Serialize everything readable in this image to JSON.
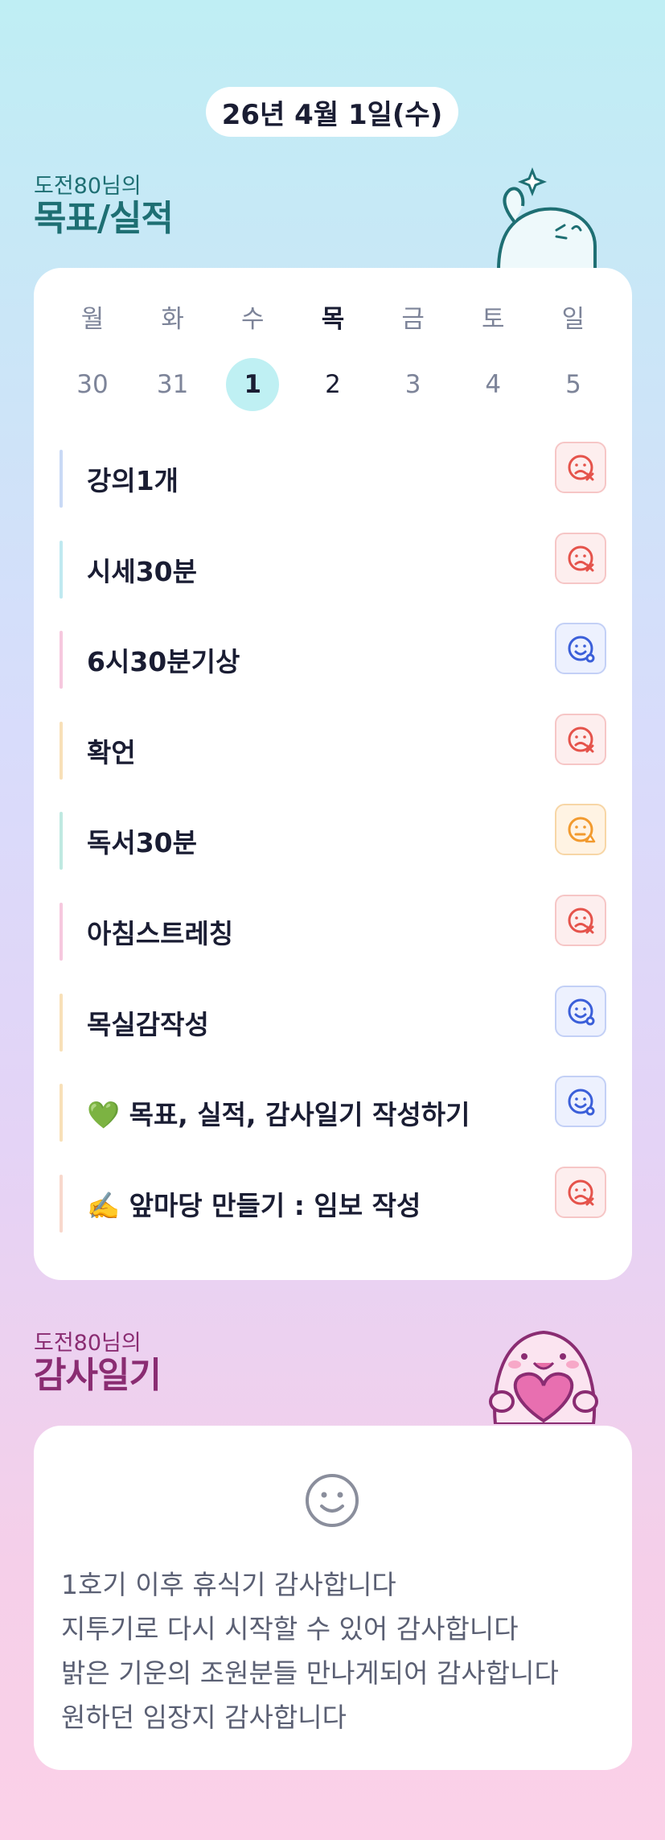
{
  "header": {
    "date": "26년 4월 1일(수)"
  },
  "goals_section": {
    "sub": "도전80님의",
    "title": "목표/실적"
  },
  "week": [
    {
      "dow": "월",
      "num": "30",
      "state": "normal"
    },
    {
      "dow": "화",
      "num": "31",
      "state": "normal"
    },
    {
      "dow": "수",
      "num": "1",
      "state": "selected"
    },
    {
      "dow": "목",
      "num": "2",
      "state": "today"
    },
    {
      "dow": "금",
      "num": "3",
      "state": "normal"
    },
    {
      "dow": "토",
      "num": "4",
      "state": "normal"
    },
    {
      "dow": "일",
      "num": "5",
      "state": "normal"
    }
  ],
  "goals": [
    {
      "text": "강의1개",
      "bar": "#c9d9f5",
      "status": "x",
      "status_icon": "sad-x-icon"
    },
    {
      "text": "시세30분",
      "bar": "#bfe9f0",
      "status": "x",
      "status_icon": "sad-x-icon"
    },
    {
      "text": "6시30분기상",
      "bar": "#f6c8de",
      "status": "o",
      "status_icon": "smile-o-icon"
    },
    {
      "text": "확언",
      "bar": "#f8e0b8",
      "status": "x",
      "status_icon": "sad-x-icon"
    },
    {
      "text": "독서30분",
      "bar": "#bfe9e1",
      "status": "t",
      "status_icon": "neutral-triangle-icon"
    },
    {
      "text": "아침스트레칭",
      "bar": "#f6c8de",
      "status": "x",
      "status_icon": "sad-x-icon"
    },
    {
      "text": "목실감작성",
      "bar": "#f8e0b8",
      "status": "o",
      "status_icon": "smile-o-icon"
    },
    {
      "text": "💚 목표, 실적, 감사일기 작성하기",
      "bar": "#f8e0b8",
      "status": "o",
      "status_icon": "smile-o-icon"
    },
    {
      "text": "✍️ 앞마당 만들기 : 임보 작성",
      "bar": "#f8d8cc",
      "status": "x",
      "status_icon": "sad-x-icon"
    }
  ],
  "gratitude_section": {
    "sub": "도전80님의",
    "title": "감사일기"
  },
  "gratitude": [
    "1호기 이후 휴식기 감사합니다",
    "지투기로 다시 시작할 수 있어 감사합니다",
    "밝은 기운의 조원분들 만나게되어 감사합니다",
    "원하던 임장지 감사합니다"
  ],
  "colors": {
    "x": "#e5534b",
    "o": "#3b5fd9",
    "t": "#f29a2e"
  }
}
